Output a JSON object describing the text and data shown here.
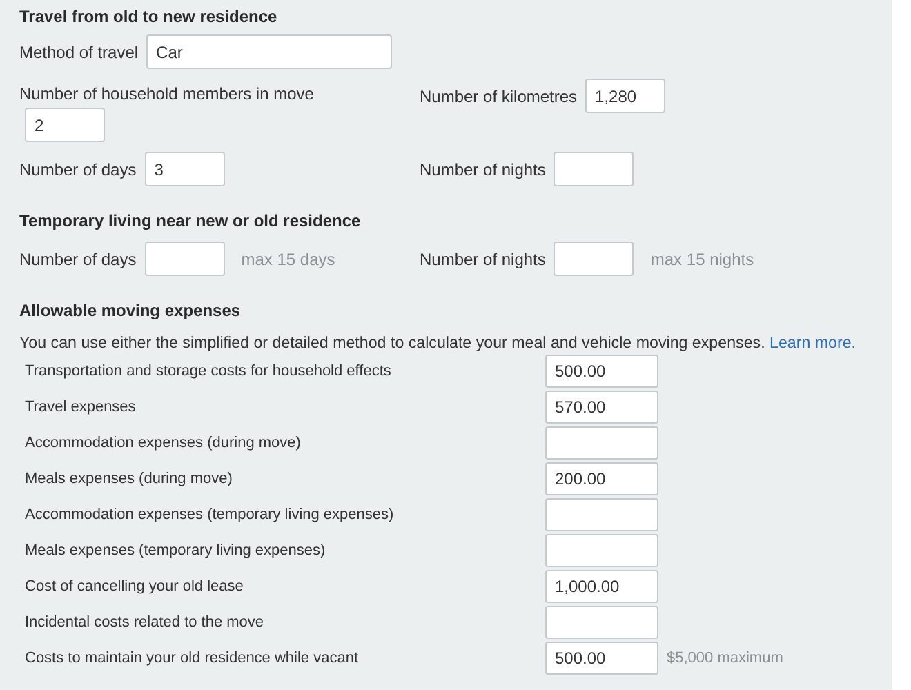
{
  "travel": {
    "title": "Travel from old to new residence",
    "method": {
      "label": "Method of travel",
      "value": "Car"
    },
    "members": {
      "label": "Number of household members in move",
      "value": "2"
    },
    "kilometres": {
      "label": "Number of kilometres",
      "value": "1,280"
    },
    "days": {
      "label": "Number of days",
      "value": "3"
    },
    "nights": {
      "label": "Number of nights"
    }
  },
  "temporary": {
    "title": "Temporary living near new or old residence",
    "days": {
      "label": "Number of days",
      "note": "max 15 days"
    },
    "nights": {
      "label": "Number of nights",
      "note": "max 15 nights"
    }
  },
  "expenses": {
    "title": "Allowable moving expenses",
    "intro": "You can use either the simplified or detailed method to calculate your meal and vehicle moving expenses.",
    "link": "Learn more.",
    "rows": [
      {
        "label": "Transportation and storage costs for household effects",
        "value": "500.00"
      },
      {
        "label": "Travel expenses",
        "value": "570.00"
      },
      {
        "label": "Accommodation expenses (during move)"
      },
      {
        "label": "Meals expenses (during move)",
        "value": "200.00"
      },
      {
        "label": "Accommodation expenses (temporary living expenses)"
      },
      {
        "label": "Meals expenses (temporary living expenses)"
      },
      {
        "label": "Cost of cancelling your old lease",
        "value": "1,000.00"
      },
      {
        "label": "Incidental costs related to the move"
      },
      {
        "label": "Costs to maintain your old residence while vacant",
        "value": "500.00",
        "note": "$5,000 maximum"
      }
    ]
  }
}
